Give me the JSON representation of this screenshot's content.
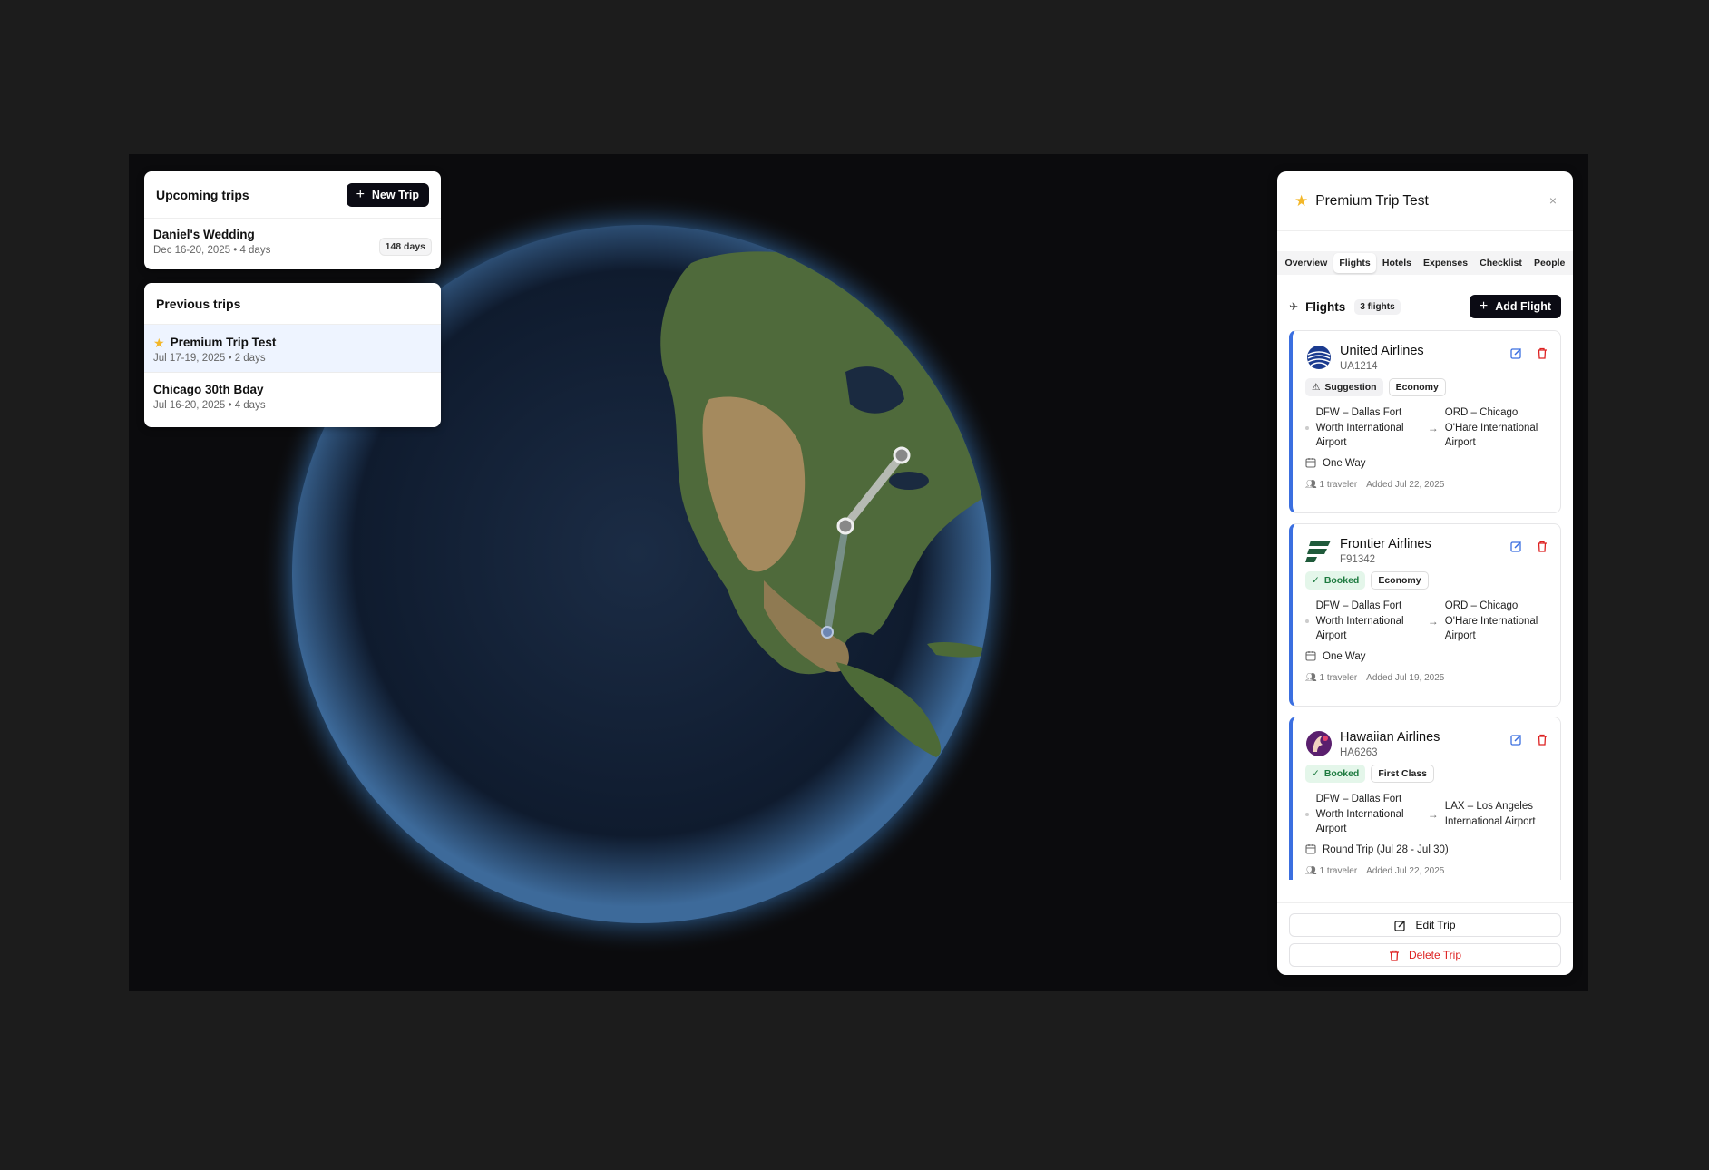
{
  "upcoming": {
    "title": "Upcoming trips",
    "new_trip_label": "New Trip",
    "trips": [
      {
        "name": "Daniel's Wedding",
        "meta": "Dec 16-20, 2025 • 4 days",
        "badge": "148 days"
      }
    ]
  },
  "previous": {
    "title": "Previous trips",
    "trips": [
      {
        "name": "Premium Trip Test",
        "meta": "Jul 17-19, 2025 • 2 days",
        "starred": true,
        "selected": true
      },
      {
        "name": "Chicago 30th Bday",
        "meta": "Jul 16-20, 2025 • 4 days"
      }
    ]
  },
  "detail": {
    "title": "Premium Trip Test",
    "close": "×",
    "tabs": [
      "Overview",
      "Flights",
      "Hotels",
      "Expenses",
      "Checklist",
      "People"
    ],
    "active_tab": "Flights",
    "flights_title": "Flights",
    "flights_count": "3 flights",
    "add_flight_label": "Add Flight",
    "flights": [
      {
        "airline": "United Airlines",
        "number": "UA1214",
        "status": "Suggestion",
        "class": "Economy",
        "from": "DFW – Dallas Fort Worth International Airport",
        "to": "ORD – Chicago O'Hare International Airport",
        "type": "One Way",
        "travelers": "1 traveler",
        "added": "Added Jul 22, 2025"
      },
      {
        "airline": "Frontier Airlines",
        "number": "F91342",
        "status": "Booked",
        "class": "Economy",
        "from": "DFW – Dallas Fort Worth International Airport",
        "to": "ORD – Chicago O'Hare International Airport",
        "type": "One Way",
        "travelers": "1 traveler",
        "added": "Added Jul 19, 2025"
      },
      {
        "airline": "Hawaiian Airlines",
        "number": "HA6263",
        "status": "Booked",
        "class": "First Class",
        "from": "DFW – Dallas Fort Worth International Airport",
        "to": "LAX – Los Angeles International Airport",
        "type": "Round Trip (Jul 28 - Jul 30)",
        "travelers": "1 traveler",
        "added": "Added Jul 22, 2025"
      }
    ],
    "edit_label": "Edit Trip",
    "delete_label": "Delete Trip"
  },
  "colors": {
    "accent": "#3b6fe0",
    "danger": "#dd2222",
    "star": "#f3b729",
    "dark_button": "#0b0b14"
  }
}
